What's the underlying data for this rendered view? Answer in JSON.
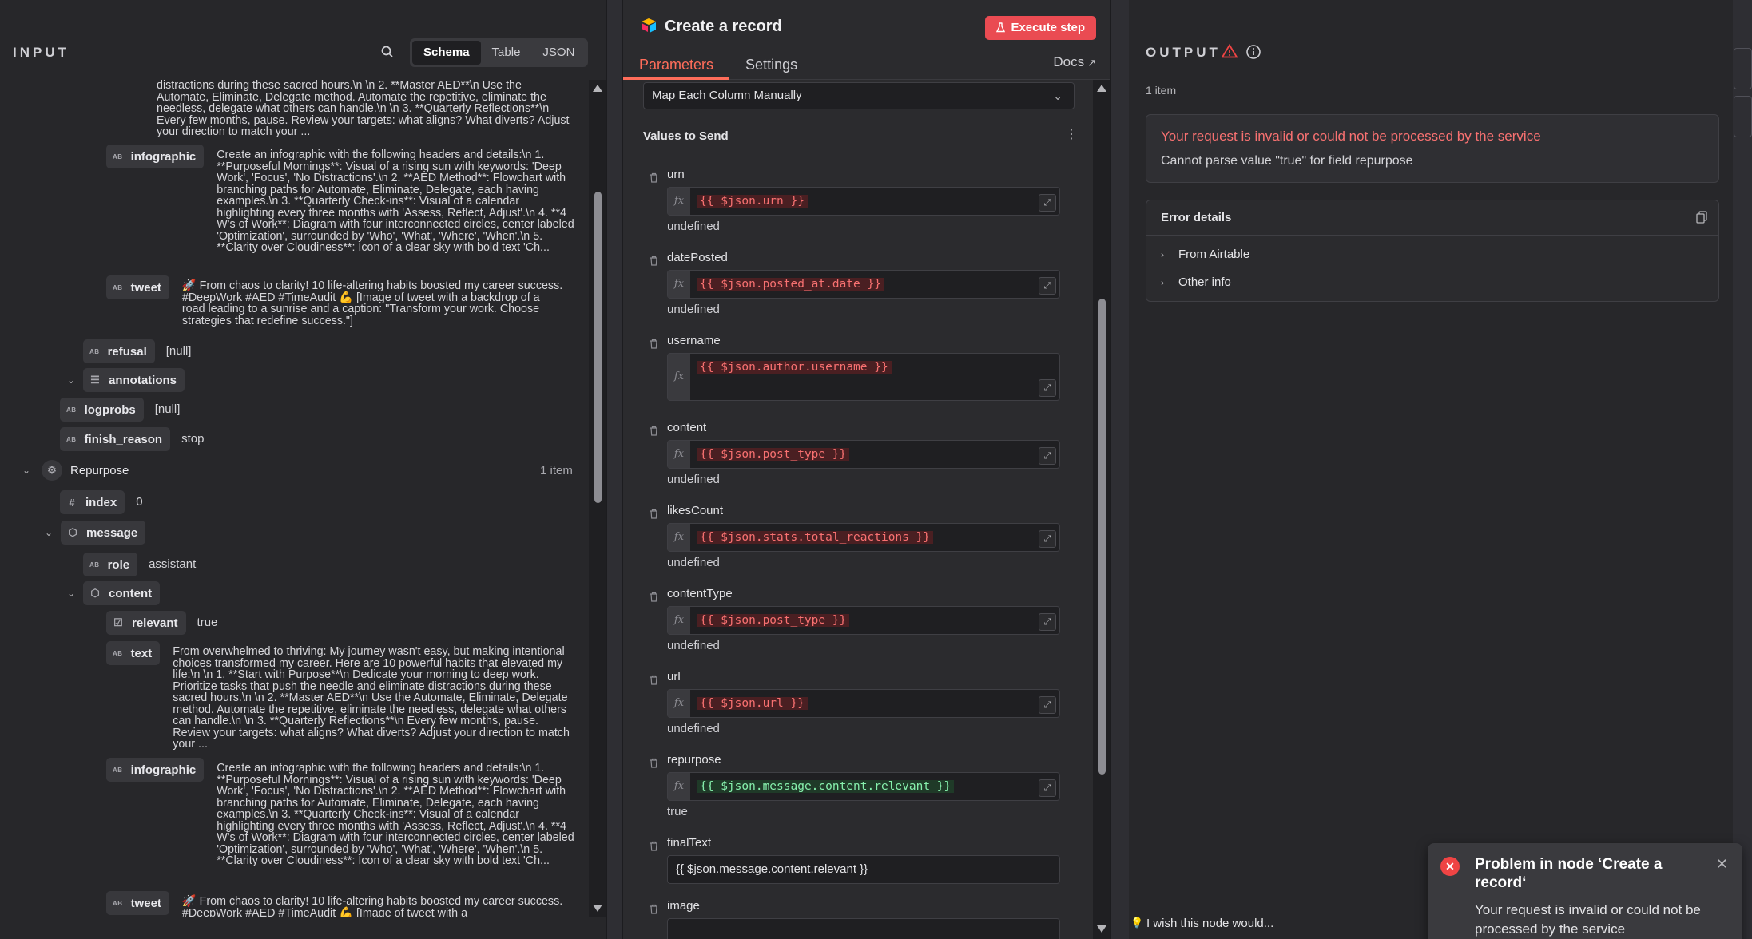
{
  "input": {
    "title": "INPUT",
    "modes": [
      "Schema",
      "Table",
      "JSON"
    ],
    "active_mode": "Schema",
    "rows_top_text": "distractions during these sacred hours.\\n \\n 2. **Master AED**\\n Use the Automate, Eliminate, Delegate method. Automate the repetitive, eliminate the needless, delegate what others can handle.\\n \\n 3. **Quarterly Reflections**\\n Every few months, pause. Review your targets: what aligns? What diverts? Adjust your direction to match your ...",
    "infographic_label": "infographic",
    "infographic_text": "Create an infographic with the following headers and details:\\n 1. **Purposeful Mornings**: Visual of a rising sun with keywords: 'Deep Work', 'Focus', 'No Distractions'.\\n 2. **AED Method**: Flowchart with branching paths for Automate, Eliminate, Delegate, each having examples.\\n 3. **Quarterly Check-ins**: Visual of a calendar highlighting every three months with 'Assess, Reflect, Adjust'.\\n 4. **4 W's of Work**: Diagram with four interconnected circles, center labeled 'Optimization', surrounded by 'Who', 'What', 'Where', 'When'.\\n 5. **Clarity over Cloudiness**: Icon of a clear sky with bold text 'Ch...",
    "tweet_label": "tweet",
    "tweet_text": "🚀 From chaos to clarity! 10 life-altering habits boosted my career success. #DeepWork #AED #TimeAudit 💪 [Image of tweet with a backdrop of a road leading to a sunrise and a caption: \"Transform your work. Choose strategies that redefine success.\"]",
    "tweet_text_cut": "🚀 From chaos to clarity! 10 life-altering habits boosted my career success. #DeepWork #AED #TimeAudit 💪 [Image of tweet with a",
    "refusal_label": "refusal",
    "refusal_value": "[null]",
    "annotations_label": "annotations",
    "logprobs_label": "logprobs",
    "logprobs_value": "[null]",
    "finish_reason_label": "finish_reason",
    "finish_reason_value": "stop",
    "repurpose_label": "Repurpose",
    "repurpose_count": "1 item",
    "index_label": "index",
    "index_value": "0",
    "message_label": "message",
    "role_label": "role",
    "role_value": "assistant",
    "content_label": "content",
    "relevant_label": "relevant",
    "relevant_value": "true",
    "text_label": "text",
    "text_value": "From overwhelmed to thriving: My journey wasn't easy, but making intentional choices transformed my career. Here are 10 powerful habits that elevated my life:\\n \\n 1. **Start with Purpose**\\n Dedicate your morning to deep work. Prioritize tasks that push the needle and eliminate distractions during these sacred hours.\\n \\n 2. **Master AED**\\n Use the Automate, Eliminate, Delegate method. Automate the repetitive, eliminate the needless, delegate what others can handle.\\n \\n 3. **Quarterly Reflections**\\n Every few months, pause. Review your targets: what aligns? What diverts? Adjust your direction to match your ..."
  },
  "node": {
    "title": "Create a record",
    "execute_label": "Execute step",
    "tabs": [
      "Parameters",
      "Settings"
    ],
    "docs_label": "Docs",
    "mapping_mode": "Map Each Column Manually",
    "values_label": "Values to Send",
    "fields": [
      {
        "name": "urn",
        "expr": "{{ $json.urn }}",
        "result": "undefined"
      },
      {
        "name": "datePosted",
        "expr": "{{ $json.posted_at.date }}",
        "result": "undefined"
      },
      {
        "name": "username",
        "expr": "{{ $json.author.username }}",
        "result": ""
      },
      {
        "name": "content",
        "expr": "{{ $json.post_type }}",
        "result": "undefined"
      },
      {
        "name": "likesCount",
        "expr": "{{ $json.stats.total_reactions }}",
        "result": "undefined"
      },
      {
        "name": "contentType",
        "expr": "{{ $json.post_type }}",
        "result": "undefined"
      },
      {
        "name": "url",
        "expr": "{{ $json.url }}",
        "result": "undefined"
      },
      {
        "name": "repurpose",
        "expr": "{{ $json.message.content.relevant }}",
        "result": "true"
      },
      {
        "name": "finalText",
        "plain": "{{ $json.message.content.relevant }}"
      },
      {
        "name": "image",
        "plain": ""
      }
    ]
  },
  "output": {
    "title": "OUTPUT",
    "items": "1 item",
    "error_title": "Your request is invalid or could not be processed by the service",
    "error_message": "Cannot parse value \"true\" for field repurpose",
    "details_title": "Error details",
    "details_items": [
      "From Airtable",
      "Other info"
    ],
    "wish": "I wish this node would..."
  },
  "toast": {
    "title": "Problem in node ‘Create a record‘",
    "message": "Your request is invalid or could not be processed by the service"
  },
  "colors": {
    "accent": "#ff6d5a",
    "error": "#f87171",
    "execute": "#ea4b52"
  }
}
